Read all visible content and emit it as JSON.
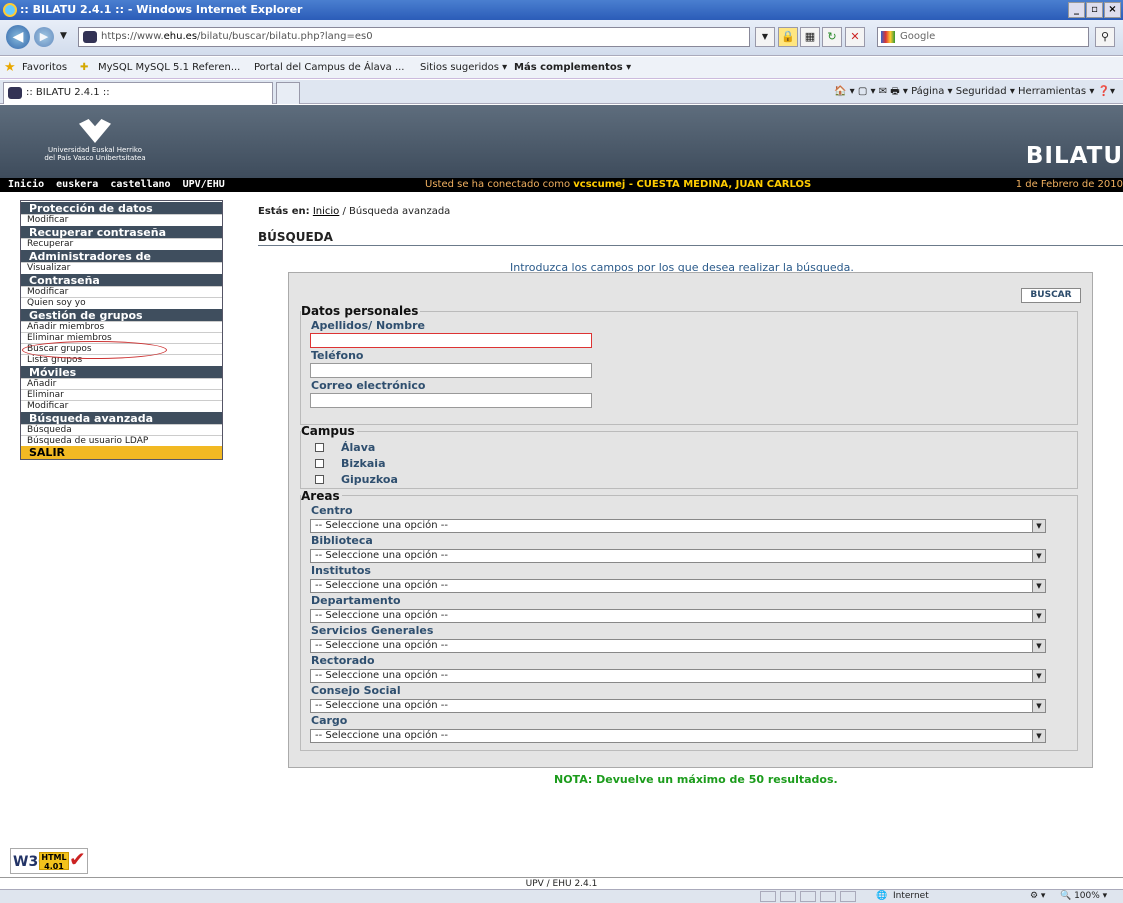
{
  "window": {
    "title": ":: BILATU 2.4.1 :: - Windows Internet Explorer",
    "controls": [
      "_",
      "̅",
      "X"
    ]
  },
  "browser": {
    "url_prefix": "https://www.",
    "url_domain": "ehu.es",
    "url_path": "/bilatu/buscar/bilatu.php?lang=es0",
    "search_provider": "Google",
    "favorites_label": "Favoritos",
    "favorites": [
      "MySQL  MySQL 5.1 Referen...",
      "Portal del Campus de Álava ...",
      "Sitios sugeridos ▾",
      "Más complementos ▾"
    ],
    "tab_title": ":: BILATU 2.4.1 ::",
    "command_bar": "🏠 ▾  ▢ ▾  ✉  🖶 ▾  Página ▾   Seguridad ▾   Herramientas ▾   ❓▾",
    "status_zone": "Internet",
    "zoom": "100%"
  },
  "header": {
    "logo_line1": "Universidad    Euskal Herriko",
    "logo_line2": "del País Vasco    Unibertsitatea",
    "brand": "BILATU"
  },
  "topnav": {
    "links": [
      "Inicio",
      "euskera",
      "castellano",
      "UPV/EHU"
    ],
    "connected_prefix": "Usted se ha conectado como ",
    "user_id": "vcscumej",
    "user_name": " - CUESTA MEDINA, JUAN CARLOS",
    "date": "1 de Febrero de 2010"
  },
  "menu": {
    "sections": [
      {
        "title": "Protección de datos",
        "items": [
          "Modificar"
        ]
      },
      {
        "title": "Recuperar contraseña",
        "items": [
          "Recuperar"
        ]
      },
      {
        "title": "Administradores de contraseñas",
        "items": [
          "Visualizar"
        ]
      },
      {
        "title": "Contraseña",
        "items": [
          "Modificar",
          "Quien soy yo"
        ]
      },
      {
        "title": "Gestión de grupos",
        "items": [
          "Añadir miembros",
          "Eliminar miembros",
          "Buscar grupos",
          "Lista grupos"
        ]
      },
      {
        "title": "Móviles",
        "items": [
          "Añadir",
          "Eliminar",
          "Modificar"
        ]
      },
      {
        "title": "Búsqueda avanzada",
        "items": [
          "Búsqueda",
          "Búsqueda de usuario LDAP"
        ]
      }
    ],
    "exit": "SALIR"
  },
  "main": {
    "breadcrumb_label": "Estás en:",
    "breadcrumb_home": "Inicio",
    "breadcrumb_current": " / Búsqueda avanzada",
    "title": "BÚSQUEDA",
    "intro": "Introduzca los campos por los que desea realizar la búsqueda.",
    "search_button": "BUSCAR",
    "personal": {
      "legend": "Datos personales",
      "fields": [
        "Apellidos/ Nombre",
        "Teléfono",
        "Correo electrónico"
      ]
    },
    "campus": {
      "legend": "Campus",
      "options": [
        "Álava",
        "Bizkaia",
        "Gipuzkoa"
      ]
    },
    "areas": {
      "legend": "Areas",
      "selects": [
        {
          "label": "Centro",
          "value": "-- Seleccione una opción --"
        },
        {
          "label": "Biblioteca",
          "value": "-- Seleccione una opción --"
        },
        {
          "label": "Institutos",
          "value": "-- Seleccione una opción --"
        },
        {
          "label": "Departamento",
          "value": "-- Seleccione una opción --"
        },
        {
          "label": "Servicios Generales",
          "value": "-- Seleccione una opción --"
        },
        {
          "label": "Rectorado",
          "value": "-- Seleccione una opción --"
        },
        {
          "label": "Consejo Social",
          "value": "-- Seleccione una opción --"
        },
        {
          "label": "Cargo",
          "value": "-- Seleccione una opción --"
        }
      ]
    },
    "note": "NOTA: Devuelve un máximo de 50 resultados."
  },
  "badge": {
    "w3c": "W3C",
    "html": "HTML 4.01"
  },
  "footer": "UPV / EHU 2.4.1"
}
